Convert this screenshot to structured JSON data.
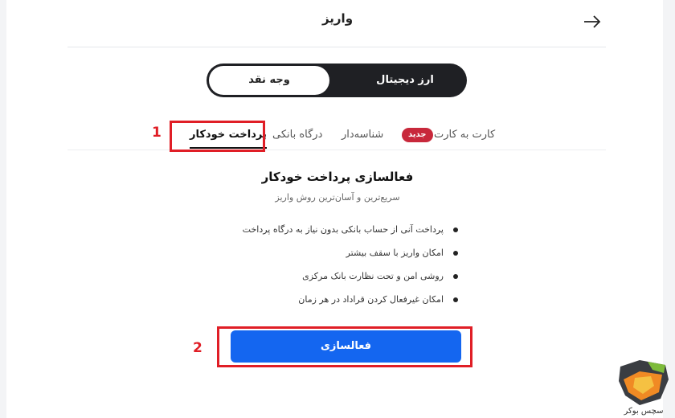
{
  "header": {
    "title": "واریز"
  },
  "deposit_type": {
    "crypto_label": "ارز دیجیتال",
    "cash_label": "وجه نقد",
    "selected": "وجه نقد"
  },
  "methods": {
    "card_to_card": "کارت به کارت",
    "new_badge": "جدید",
    "shenaseh": "شناسه‌دار",
    "bank_gateway": "درگاه بانکی",
    "auto_payment": "پرداخت خودکار",
    "active": "پرداخت خودکار"
  },
  "content": {
    "title": "فعالسازی پرداخت خودکار",
    "subtitle": "سریع‌ترین و آسان‌ترین روش واریز",
    "features": [
      "پرداخت آنی از حساب بانکی بدون نیاز به درگاه پرداخت",
      "امکان واریز با سقف بیشتر",
      "روشی امن و تحت نظارت بانک مرکزی",
      "امکان غیرفعال کردن قراداد در هر زمان"
    ],
    "activate_label": "فعالسازی"
  },
  "annotations": {
    "step1": "1",
    "step2": "2"
  },
  "watermark": {
    "text": "سچس بوکر"
  },
  "icons": {
    "back": "arrow-right-icon",
    "bullet": "bullet-icon"
  },
  "colors": {
    "accent": "#1466f0",
    "badge": "#c8283b",
    "highlight": "#e01e26",
    "toggle_dark": "#1f2024"
  }
}
